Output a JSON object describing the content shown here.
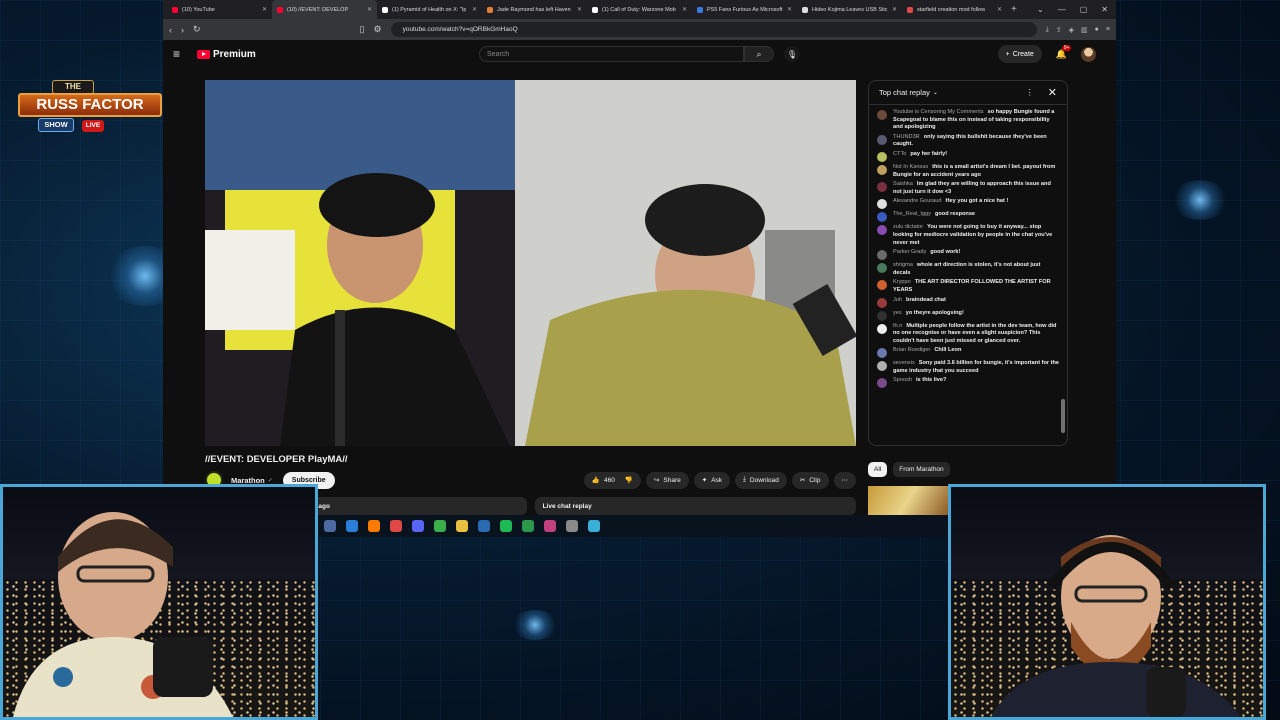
{
  "colors": {
    "accent": "#ff0033",
    "frame": "#4aa8d8",
    "browser_bg": "#0f0f0f"
  },
  "browser": {
    "tabs": [
      {
        "label": "(10) YouTube",
        "favicon": "#ff0033",
        "active": false
      },
      {
        "label": "(10) //EVENT: DEVELOP",
        "favicon": "#ff0033",
        "active": true
      },
      {
        "label": "(1) Pyramid of Health on X: \"Ip",
        "favicon": "#ffffff",
        "active": false
      },
      {
        "label": "Jade Raymond has left Haven",
        "favicon": "#e0803a",
        "active": false
      },
      {
        "label": "(1) Call of Duty: Warzone Mob",
        "favicon": "#ffffff",
        "active": false
      },
      {
        "label": "PS5 Fans Furious As Microsoft",
        "favicon": "#3a7be0",
        "active": false
      },
      {
        "label": "Hideo Kojima Leaves USB Stic",
        "favicon": "#dddddd",
        "active": false
      },
      {
        "label": "starfield creation mod follow",
        "favicon": "#e04848",
        "active": false
      }
    ],
    "url": "youtube.com/watch?v=qORBkGmHaoQ"
  },
  "youtube": {
    "brand": "Premium",
    "search_placeholder": "Search",
    "create_label": "Create",
    "notif_count": "9+",
    "video_title": "//EVENT: DEVELOPER PlayMA//",
    "channel_name": "Marathon",
    "subscribe_label": "Subscribe",
    "actions": {
      "like_count": "460",
      "share": "Share",
      "ask": "Ask",
      "download": "Download",
      "clip": "Clip"
    },
    "desc_left": "ous ago",
    "desc_right": "Live chat replay",
    "chips": [
      "All",
      "From Marathon"
    ]
  },
  "chat": {
    "title": "Top chat replay",
    "messages": [
      {
        "author": "Youtube is Censoring My Comments",
        "text": "so happy Bungie found a Scapegoat to blame this on instead of taking responsibility and apologizing",
        "color": "#6b4a3a"
      },
      {
        "author": "THUND3R",
        "text": "only saying this bullshit because they've been caught.",
        "color": "#5a5a70"
      },
      {
        "author": "CTTo",
        "text": "pay her fairly!",
        "color": "#b8c060"
      },
      {
        "author": "Not In Kansas",
        "text": "this is a small artist's dream I bet. payout from Bungie for an accident years ago",
        "color": "#c0a060"
      },
      {
        "author": "Saishka",
        "text": "Im glad they are willing to approach this issue and not just turn it dow <3",
        "color": "#7a3040"
      },
      {
        "author": "Alexandre Gouraud",
        "text": "Hey you got a nice hat !",
        "color": "#e0e0e0"
      },
      {
        "author": "The_Real_Iggy",
        "text": "good response",
        "color": "#3a5ac0"
      },
      {
        "author": "zulu dictator",
        "text": "You were not going to buy it anyway... stop looking for mediocre validation by people in the chat you've never met",
        "color": "#8a4ab0"
      },
      {
        "author": "Parker Grady",
        "text": "good work!",
        "color": "#6a6a6a"
      },
      {
        "author": "shrigma",
        "text": "whole art direction is stolen, it's not about just decals",
        "color": "#4a7a5a"
      },
      {
        "author": "Kryppo",
        "text": "THE ART DIRECTOR FOLLOWED THE ARTIST FOR YEARS",
        "color": "#d06030"
      },
      {
        "author": "Juh",
        "text": "braindead chat",
        "color": "#9a3a3a"
      },
      {
        "author": "yes",
        "text": "yo theyre apologsing!",
        "color": "#303030"
      },
      {
        "author": "th.n",
        "text": "Multiple people follow the artist in the dev team, how did no one recognise or have even a slight suspicion? This couldn't have been just missed or glanced over.",
        "color": "#f0f0f0"
      },
      {
        "author": "Brian Roediger",
        "text": "Chill Leon",
        "color": "#6a7ab0"
      },
      {
        "author": "sevensix",
        "text": "Sony paid 3.6 billion for bungie, it's important for the game industry that you succeed",
        "color": "#b0b0b0"
      },
      {
        "author": "Spoosh",
        "text": "is this live?",
        "color": "#7a4a8a"
      }
    ]
  },
  "overlay": {
    "logo_the": "THE",
    "logo_main": "RUSS FACTOR",
    "logo_show": "SHOW",
    "logo_live": "LIVE"
  },
  "taskbar_icons": [
    "#4a6aa0",
    "#2a80d8",
    "#ff7a00",
    "#e04848",
    "#5865f2",
    "#3ab04a",
    "#e8c040",
    "#2a6ab0",
    "#1db954",
    "#2a9a4a",
    "#c04080",
    "#8a8a8a",
    "#3ab0d8"
  ]
}
